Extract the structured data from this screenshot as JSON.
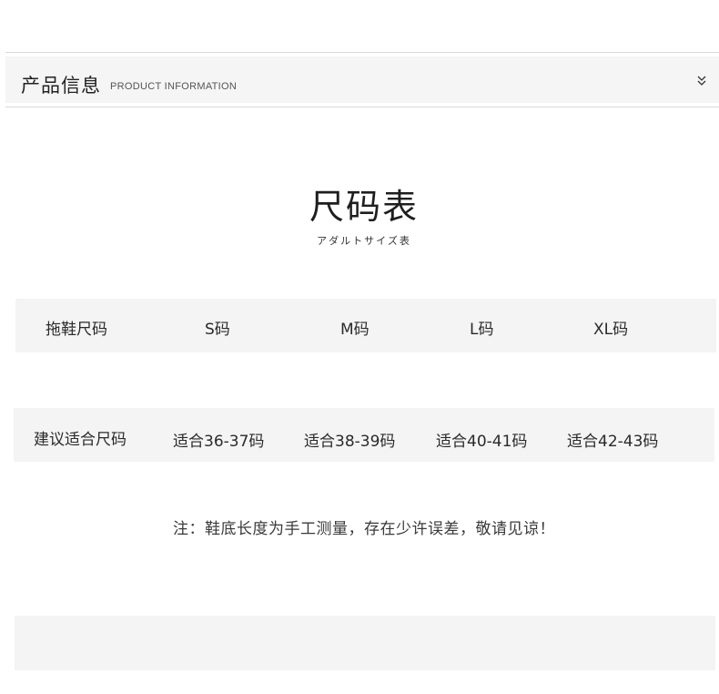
{
  "header": {
    "title": "产品信息",
    "subtitle": "PRODUCT INFORMATION",
    "toggle_icon": "double-chevron-down-icon"
  },
  "size_chart": {
    "title": "尺码表",
    "subtitle": "アダルトサイズ表"
  },
  "chart_data": {
    "type": "table",
    "rows": [
      {
        "label": "拖鞋尺码",
        "values": [
          "S码",
          "M码",
          "L码",
          "XL码"
        ]
      },
      {
        "label": "建议适合尺码",
        "values": [
          "适合36-37码",
          "适合38-39码",
          "适合40-41码",
          "适合42-43码"
        ]
      }
    ]
  },
  "note": "注：鞋底长度为手工测量，存在少许误差，敬请见谅！",
  "colors": {
    "band": "#f4f4f4",
    "text": "#2a2a2a",
    "rule": "#d9d9d9"
  }
}
